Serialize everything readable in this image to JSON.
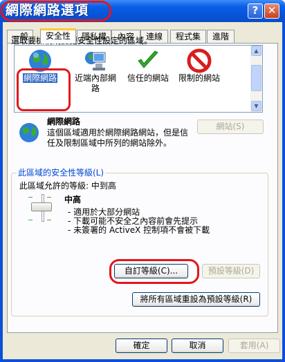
{
  "window": {
    "title": "網際網路選項",
    "help_glyph": "?",
    "close_glyph": "✕"
  },
  "tabs": [
    {
      "label": "一般",
      "active": false
    },
    {
      "label": "安全性",
      "active": true
    },
    {
      "label": "隱私權",
      "active": false
    },
    {
      "label": "內容",
      "active": false
    },
    {
      "label": "連線",
      "active": false
    },
    {
      "label": "程式集",
      "active": false
    },
    {
      "label": "進階",
      "active": false
    }
  ],
  "zones": {
    "prompt": "選取要檢視或變更安全性設定的區域。",
    "items": [
      {
        "label": "網際網路",
        "icon": "globe-icon",
        "selected": true
      },
      {
        "label": "近端內部網路",
        "icon": "intranet-icon",
        "selected": false
      },
      {
        "label": "信任的網站",
        "icon": "checkmark-icon",
        "selected": false
      },
      {
        "label": "限制的網站",
        "icon": "no-entry-icon",
        "selected": false
      }
    ]
  },
  "zone_description": {
    "title": "網際網路",
    "text": "這個區域適用於網際網路網站，但是信任及限制區域中所列的網站除外。",
    "sites_button": "網站(S)"
  },
  "security_level": {
    "group_label": "此區域的安全性等級(L)",
    "allowed_levels": "此區域允許的等級: 中到高",
    "level_name": "中高",
    "slider_level": "中高",
    "bullets": [
      "- 適用於大部分網站",
      "- 下載可能不安全之內容前會先提示",
      "- 未簽署的 ActiveX 控制項不會被下載"
    ],
    "custom_level_button": "自訂等級(C)...",
    "default_level_button": "預設等級(D)",
    "reset_all_button": "將所有區域重設為預設等級(R)"
  },
  "dialog_buttons": {
    "ok": "確定",
    "cancel": "取消",
    "apply": "套用(A)"
  },
  "colors": {
    "titlebar": "#0a5fe8",
    "highlight_ring": "#e4151b",
    "selection": "#316ac5",
    "group_label": "#0046d5"
  }
}
